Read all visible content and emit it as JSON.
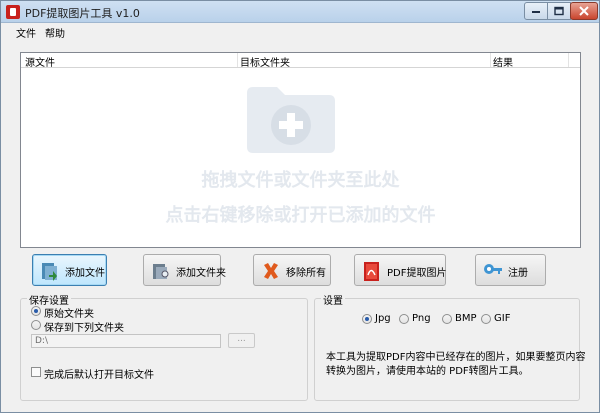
{
  "window": {
    "title": "PDF提取图片工具 v1.0"
  },
  "menu": {
    "items": [
      "文件",
      "帮助"
    ]
  },
  "list": {
    "columns": [
      "源文件",
      "目标文件夹",
      "结果"
    ],
    "watermark_line1": "拖拽文件或文件夹至此处",
    "watermark_line2": "点击右键移除或打开已添加的文件"
  },
  "buttons": {
    "add_file": "添加文件",
    "add_folder": "添加文件夹",
    "remove_all": "移除所有",
    "extract": "PDF提取图片",
    "register": "注册"
  },
  "save_settings": {
    "title": "保存设置",
    "option_original": "原始文件夹",
    "option_custom": "保存到下列文件夹",
    "path_value": "D:\\",
    "browse_label": "...",
    "open_after": "完成后默认打开目标文件"
  },
  "settings": {
    "title": "设置",
    "formats": [
      "Jpg",
      "Png",
      "BMP",
      "GIF"
    ],
    "selected_format": "Jpg",
    "note_line1": "本工具为提取PDF内容中已经存在的图片，如果要整页内容",
    "note_line2": "转换为图片，请使用本站的 PDF转图片工具。"
  }
}
